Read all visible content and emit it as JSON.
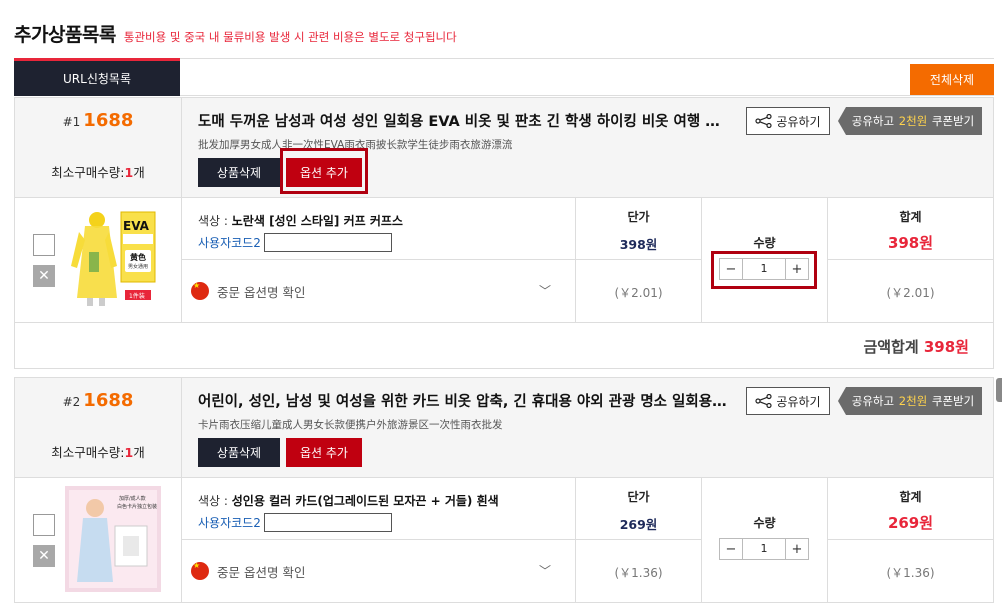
{
  "header": {
    "title": "추가상품목록",
    "note": "통관비용 및 중국 내 물류비용 발생 시 관련 비용은 별도로 청구됩니다"
  },
  "tabs": {
    "url_list": "URL신청목록",
    "delete_all": "전체삭제"
  },
  "products": [
    {
      "index": "#1",
      "source": "1688",
      "min_label": "최소구매수량:",
      "min_qty": "1",
      "min_unit": "개",
      "title": "도매 두꺼운 남성과 여성 성인 일회용 EVA 비옷 및 판초 긴 학생 하이킹 비옷 여행 래프팅",
      "subtitle": "批发加厚男女成人非一次性EVA雨衣雨披长款学生徒步雨衣旅游漂流",
      "delete_btn": "상품삭제",
      "option_btn": "옵션 추가",
      "share_btn": "공유하기",
      "coupon_pre": "공유하고",
      "coupon_amount": "2천원",
      "coupon_post": "쿠폰받기",
      "color_label": "색상 : ",
      "color_value": "노란색 [성인 스타일] 커프 커프스",
      "code_label": "사용자코드2",
      "code_value": "",
      "cn_option": "중문 옵션명 확인",
      "unit_price_label": "단가",
      "unit_price": "398원",
      "unit_cny": "(￥2.01)",
      "qty_label": "수량",
      "qty": "1",
      "total_label": "합계",
      "total": "398원",
      "total_cny": "(￥2.01)",
      "sum_label": "금액합계",
      "sum_value": "398원"
    },
    {
      "index": "#2",
      "source": "1688",
      "min_label": "최소구매수량:",
      "min_qty": "1",
      "min_unit": "개",
      "title": "어린이, 성인, 남성 및 여성을 위한 카드 비옷 압축, 긴 휴대용 야외 관광 명소 일회용 비옷",
      "subtitle": "卡片雨衣压缩儿童成人男女长款便携户外旅游景区一次性雨衣批发",
      "delete_btn": "상품삭제",
      "option_btn": "옵션 추가",
      "share_btn": "공유하기",
      "coupon_pre": "공유하고",
      "coupon_amount": "2천원",
      "coupon_post": "쿠폰받기",
      "color_label": "색상 : ",
      "color_value": "성인용 컬러 카드(업그레이드된 모자끈 + 거들) 흰색",
      "code_label": "사용자코드2",
      "code_value": "",
      "cn_option": "중문 옵션명 확인",
      "unit_price_label": "단가",
      "unit_price": "269원",
      "unit_cny": "(￥1.36)",
      "qty_label": "수량",
      "qty": "1",
      "total_label": "합계",
      "total": "269원",
      "total_cny": "(￥1.36)"
    }
  ],
  "colors": {
    "accent_red": "#e8263a",
    "brand_orange": "#f46b00",
    "dark_navy": "#1e2230"
  }
}
